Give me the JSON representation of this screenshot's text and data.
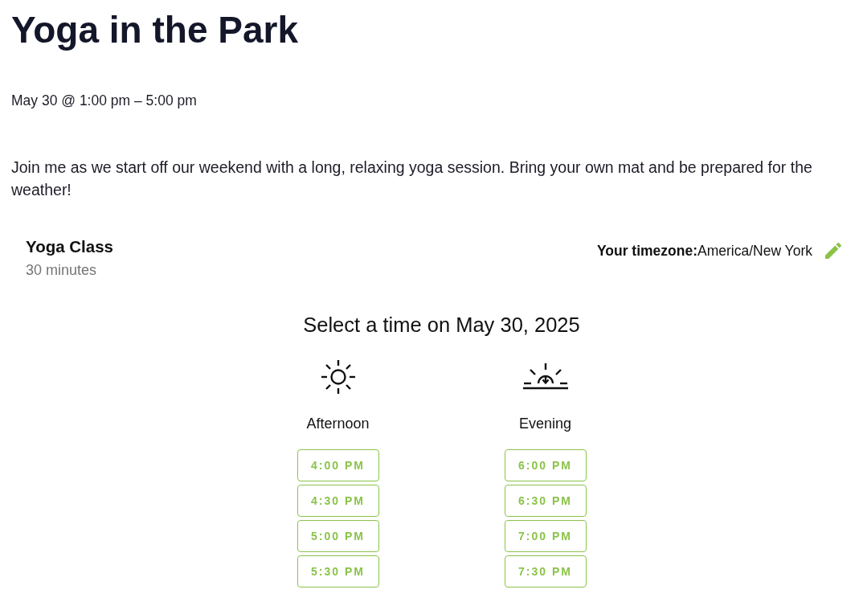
{
  "event": {
    "title": "Yoga in the Park",
    "datetime": "May 30 @ 1:00 pm – 5:00 pm",
    "description": "Join me as we start off our weekend with a long, relaxing yoga session. Bring your own mat and be prepared for the weather!"
  },
  "booking": {
    "service": "Yoga Class",
    "duration": "30 minutes",
    "timezone": "**Your timezone:**America/New York",
    "heading": "Select a time on May 30, 2025",
    "periods": [
      {
        "kind": "afternoon",
        "label": "Afternoon",
        "slots": [
          {
            "time": "4:00 PM",
            "selected": false
          },
          {
            "time": "4:30 PM",
            "selected": false
          },
          {
            "time": "5:00 PM",
            "selected": false
          },
          {
            "time": "5:30 PM",
            "selected": false
          }
        ]
      },
      {
        "kind": "evening",
        "label": "Evening",
        "slots": [
          {
            "time": "6:00 PM",
            "selected": false
          },
          {
            "time": "6:30 PM",
            "selected": false
          },
          {
            "time": "7:00 PM",
            "selected": false
          },
          {
            "time": "7:30 PM",
            "selected": false
          }
        ]
      }
    ]
  }
}
